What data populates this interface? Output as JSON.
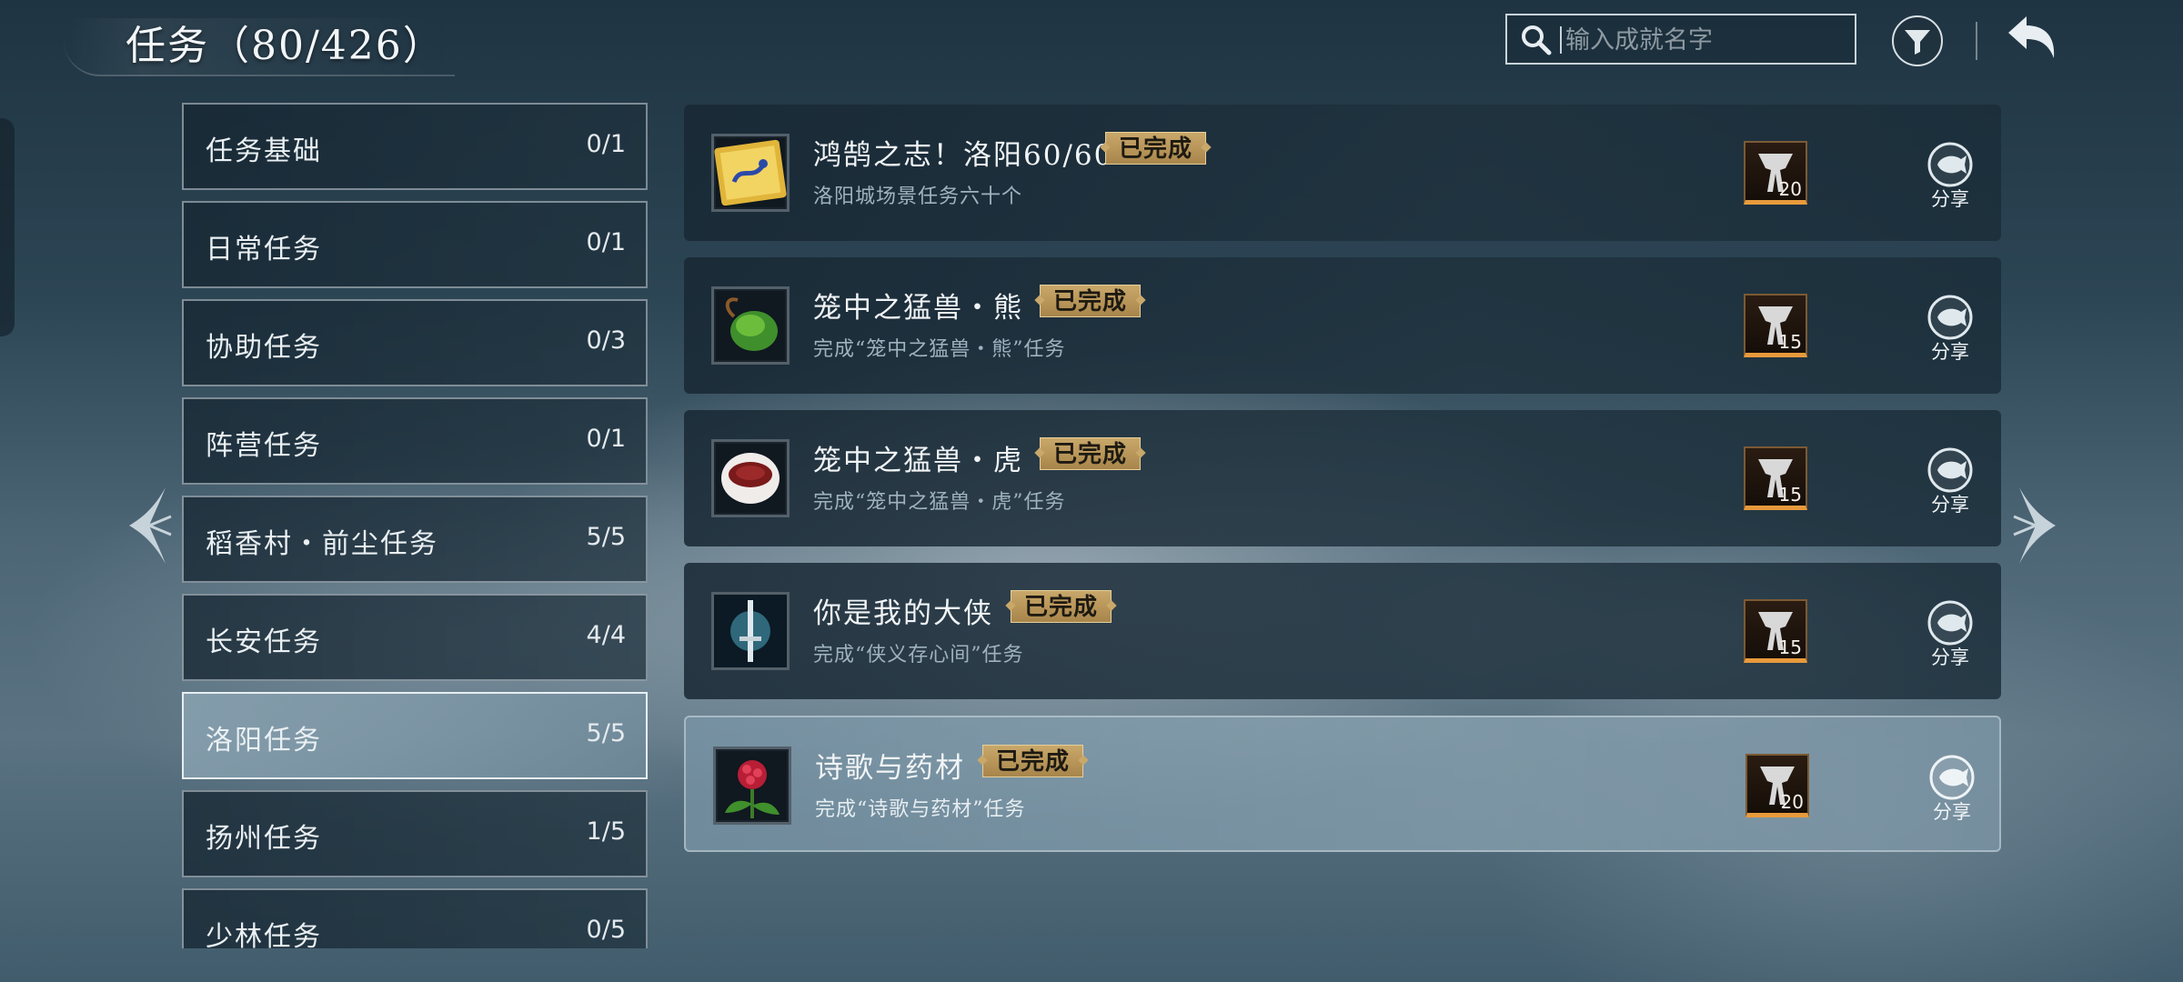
{
  "header": {
    "title": "任务（80/426）",
    "search_placeholder": "输入成就名字"
  },
  "categories": [
    {
      "label": "任务基础",
      "count": "0/1",
      "active": false
    },
    {
      "label": "日常任务",
      "count": "0/1",
      "active": false
    },
    {
      "label": "协助任务",
      "count": "0/3",
      "active": false
    },
    {
      "label": "阵营任务",
      "count": "0/1",
      "active": false
    },
    {
      "label": "稻香村・前尘任务",
      "count": "5/5",
      "active": false
    },
    {
      "label": "长安任务",
      "count": "4/4",
      "active": false
    },
    {
      "label": "洛阳任务",
      "count": "5/5",
      "active": true
    },
    {
      "label": "扬州任务",
      "count": "1/5",
      "active": false
    },
    {
      "label": "少林任务",
      "count": "0/5",
      "active": false
    }
  ],
  "achievements": [
    {
      "title": "鸿鹄之志！洛阳60/60",
      "desc": "洛阳城场景任务六十个",
      "badge": "已完成",
      "reward": "20",
      "share_label": "分享",
      "icon": "scroll-icon"
    },
    {
      "title": "笼中之猛兽・熊",
      "desc": "完成“笼中之猛兽・熊”任务",
      "badge": "已完成",
      "reward": "15",
      "share_label": "分享",
      "icon": "gourd-icon"
    },
    {
      "title": "笼中之猛兽・虎",
      "desc": "完成“笼中之猛兽・虎”任务",
      "badge": "已完成",
      "reward": "15",
      "share_label": "分享",
      "icon": "bowl-icon"
    },
    {
      "title": "你是我的大侠",
      "desc": "完成“侠义存心间”任务",
      "badge": "已完成",
      "reward": "15",
      "share_label": "分享",
      "icon": "sword-icon"
    },
    {
      "title": "诗歌与药材",
      "desc": "完成“诗歌与药材”任务",
      "badge": "已完成",
      "reward": "20",
      "share_label": "分享",
      "icon": "berry-plant-icon"
    }
  ],
  "colors": {
    "badge_gold": "#c9a86a",
    "reward_bar": "#e89a3c"
  }
}
